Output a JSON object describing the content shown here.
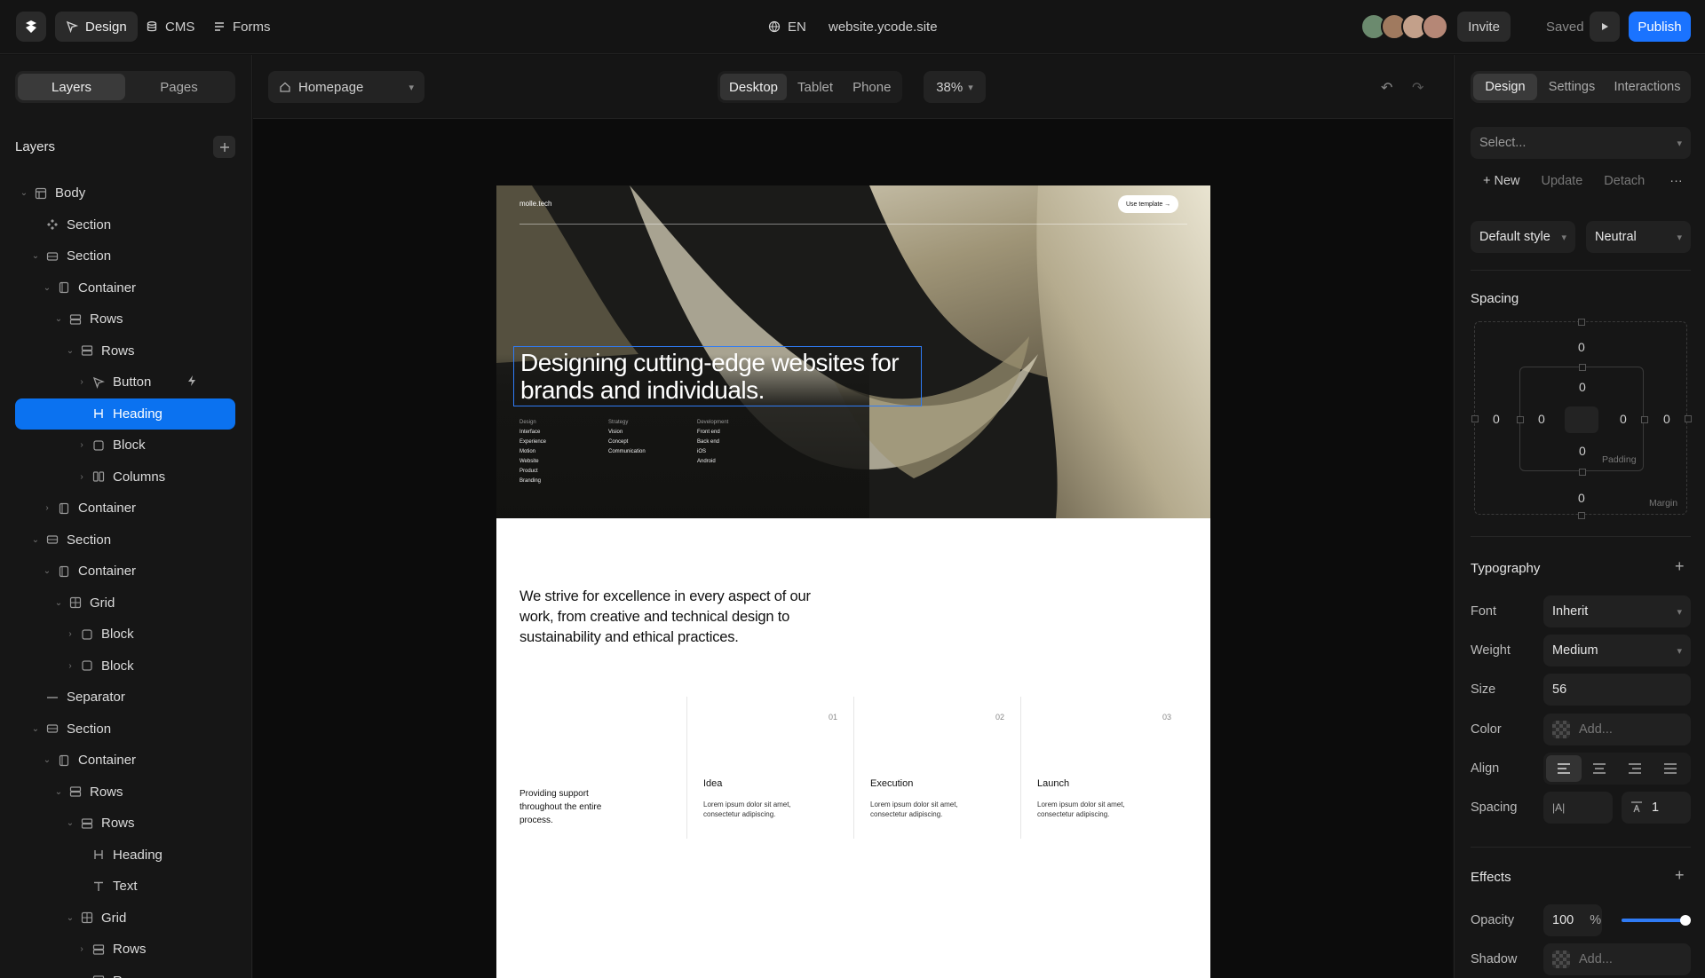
{
  "topbar": {
    "nav": [
      {
        "label": "Design",
        "icon": "cursor-icon",
        "active": true
      },
      {
        "label": "CMS",
        "icon": "database-icon",
        "active": false
      },
      {
        "label": "Forms",
        "icon": "form-icon",
        "active": false
      }
    ],
    "language": "EN",
    "site_url": "website.ycode.site",
    "invite_label": "Invite",
    "saved_label": "Saved",
    "publish_label": "Publish",
    "accent_color": "#1a73ff"
  },
  "left_panel": {
    "tabs": [
      {
        "label": "Layers",
        "active": true
      },
      {
        "label": "Pages",
        "active": false
      }
    ],
    "title": "Layers",
    "tree": [
      {
        "label": "Body",
        "depth": 0,
        "icon": "layout-icon",
        "caret": "open"
      },
      {
        "label": "Section",
        "depth": 1,
        "icon": "component-icon",
        "caret": "none"
      },
      {
        "label": "Section",
        "depth": 1,
        "icon": "section-icon",
        "caret": "open"
      },
      {
        "label": "Container",
        "depth": 2,
        "icon": "container-icon",
        "caret": "open"
      },
      {
        "label": "Rows",
        "depth": 3,
        "icon": "rows-icon",
        "caret": "open"
      },
      {
        "label": "Rows",
        "depth": 4,
        "icon": "rows-icon",
        "caret": "open"
      },
      {
        "label": "Button",
        "depth": 5,
        "icon": "cursor-icon",
        "caret": "closed",
        "badge": "bolt-icon"
      },
      {
        "label": "Heading",
        "depth": 5,
        "icon": "heading-icon",
        "caret": "none",
        "selected": true
      },
      {
        "label": "Block",
        "depth": 5,
        "icon": "block-icon",
        "caret": "closed"
      },
      {
        "label": "Columns",
        "depth": 5,
        "icon": "columns-icon",
        "caret": "closed"
      },
      {
        "label": "Container",
        "depth": 2,
        "icon": "container-icon",
        "caret": "closed"
      },
      {
        "label": "Section",
        "depth": 1,
        "icon": "section-icon",
        "caret": "open"
      },
      {
        "label": "Container",
        "depth": 2,
        "icon": "container-icon",
        "caret": "open"
      },
      {
        "label": "Grid",
        "depth": 3,
        "icon": "grid-icon",
        "caret": "open"
      },
      {
        "label": "Block",
        "depth": 4,
        "icon": "block-icon",
        "caret": "closed"
      },
      {
        "label": "Block",
        "depth": 4,
        "icon": "block-icon",
        "caret": "closed"
      },
      {
        "label": "Separator",
        "depth": 1,
        "icon": "separator-icon",
        "caret": "none"
      },
      {
        "label": "Section",
        "depth": 1,
        "icon": "section-icon",
        "caret": "open"
      },
      {
        "label": "Container",
        "depth": 2,
        "icon": "container-icon",
        "caret": "open"
      },
      {
        "label": "Rows",
        "depth": 3,
        "icon": "rows-icon",
        "caret": "open"
      },
      {
        "label": "Rows",
        "depth": 4,
        "icon": "rows-icon",
        "caret": "open"
      },
      {
        "label": "Heading",
        "depth": 5,
        "icon": "heading-icon",
        "caret": "none"
      },
      {
        "label": "Text",
        "depth": 5,
        "icon": "text-icon",
        "caret": "none"
      },
      {
        "label": "Grid",
        "depth": 4,
        "icon": "grid-icon",
        "caret": "open"
      },
      {
        "label": "Rows",
        "depth": 5,
        "icon": "rows-icon",
        "caret": "closed"
      },
      {
        "label": "Rows",
        "depth": 5,
        "icon": "rows-icon",
        "caret": "closed"
      }
    ]
  },
  "canvas_header": {
    "page": "Homepage",
    "devices": [
      {
        "label": "Desktop",
        "active": true
      },
      {
        "label": "Tablet",
        "active": false
      },
      {
        "label": "Phone",
        "active": false
      }
    ],
    "zoom": "38%"
  },
  "site": {
    "logo": "molle.tech",
    "cta": "Use template →",
    "heading": "Designing cutting-edge websites for brands and individuals.",
    "columns": [
      {
        "head": "Design",
        "items": [
          "Interface",
          "Experience",
          "Motion",
          "Website",
          "Product",
          "Branding"
        ]
      },
      {
        "head": "Strategy",
        "items": [
          "Vision",
          "Concept",
          "Communication"
        ]
      },
      {
        "head": "Development",
        "items": [
          "Front end",
          "Back end",
          "iOS",
          "Android"
        ]
      }
    ],
    "lead": "We strive for excellence in every aspect of our work, from creative and technical design to sustainability and ethical practices.",
    "support_text": "Providing support throughout the entire process.",
    "steps": [
      {
        "num": "01",
        "title": "Idea",
        "desc": "Lorem ipsum dolor sit amet, consectetur adipiscing."
      },
      {
        "num": "02",
        "title": "Execution",
        "desc": "Lorem ipsum dolor sit amet, consectetur adipiscing."
      },
      {
        "num": "03",
        "title": "Launch",
        "desc": "Lorem ipsum dolor sit amet, consectetur adipiscing."
      }
    ]
  },
  "right_panel": {
    "tabs": [
      {
        "label": "Design",
        "active": true
      },
      {
        "label": "Settings",
        "active": false
      },
      {
        "label": "Interactions",
        "active": false
      }
    ],
    "style_select_placeholder": "Select...",
    "style_actions": {
      "new": "New",
      "update": "Update",
      "detach": "Detach",
      "more": "···"
    },
    "default_style": "Default style",
    "theme": "Neutral",
    "spacing": {
      "title": "Spacing",
      "margin": {
        "top": "0",
        "right": "0",
        "bottom": "0",
        "left": "0"
      },
      "padding": {
        "top": "0",
        "right": "0",
        "bottom": "0",
        "left": "0"
      },
      "padding_label": "Padding",
      "margin_label": "Margin"
    },
    "typography": {
      "title": "Typography",
      "font_label": "Font",
      "font": "Inherit",
      "weight_label": "Weight",
      "weight": "Medium",
      "size_label": "Size",
      "size": "56",
      "color_label": "Color",
      "color_placeholder": "Add...",
      "align_label": "Align",
      "spacing_label": "Spacing",
      "letter_spacing_icon": "|A|",
      "line_height": "1"
    },
    "effects": {
      "title": "Effects",
      "opacity_label": "Opacity",
      "opacity": "100",
      "opacity_unit": "%",
      "opacity_level": 1.0,
      "shadow_label": "Shadow",
      "shadow_placeholder": "Add..."
    }
  }
}
